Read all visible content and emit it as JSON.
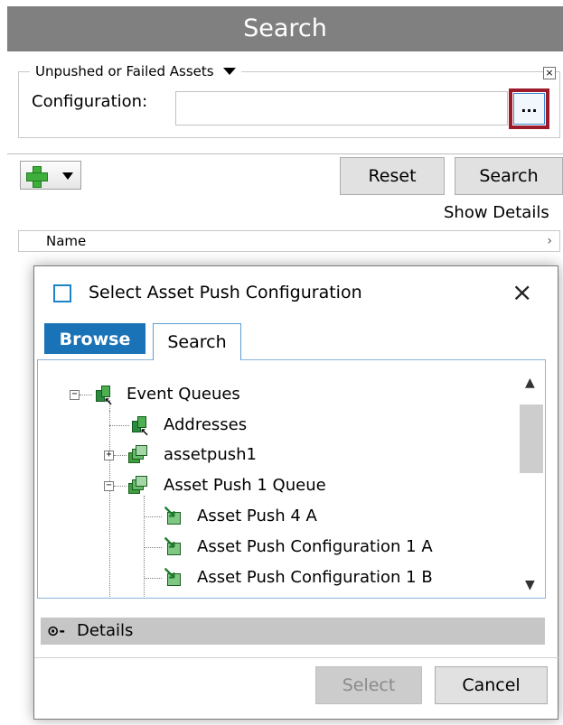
{
  "header": {
    "title": "Search"
  },
  "filter": {
    "group_title": "Unpushed or Failed Assets",
    "close_glyph": "×",
    "configuration_label": "Configuration:",
    "configuration_value": "",
    "browse_label": "..."
  },
  "toolbar": {
    "reset_label": "Reset",
    "search_label": "Search",
    "show_details_label": "Show Details"
  },
  "results": {
    "column_name": "Name",
    "chevron": "›"
  },
  "dialog": {
    "title": "Select Asset Push Configuration",
    "close_glyph": "×",
    "tabs": [
      {
        "label": "Browse",
        "active": true
      },
      {
        "label": "Search",
        "active": false
      }
    ],
    "tree": [
      {
        "label": "Event Queues",
        "icon": "event-queue-icon",
        "expander": "−"
      },
      {
        "label": "Addresses",
        "icon": "event-queue-icon"
      },
      {
        "label": "assetpush1",
        "icon": "queue-icon",
        "expander": "+"
      },
      {
        "label": "Asset Push 1 Queue",
        "icon": "queue-icon",
        "expander": "−"
      },
      {
        "label": "Asset Push 4 A",
        "icon": "asset-push-config-icon"
      },
      {
        "label": "Asset Push Configuration 1 A",
        "icon": "asset-push-config-icon"
      },
      {
        "label": "Asset Push Configuration 1 B",
        "icon": "asset-push-config-icon"
      }
    ],
    "details_label": "Details",
    "select_label": "Select",
    "cancel_label": "Cancel"
  },
  "colors": {
    "header_bg": "#808080",
    "browse_tab_bg": "#1a72b7",
    "highlight_border": "#9b1b2a",
    "add_green": "#3fae3c"
  }
}
